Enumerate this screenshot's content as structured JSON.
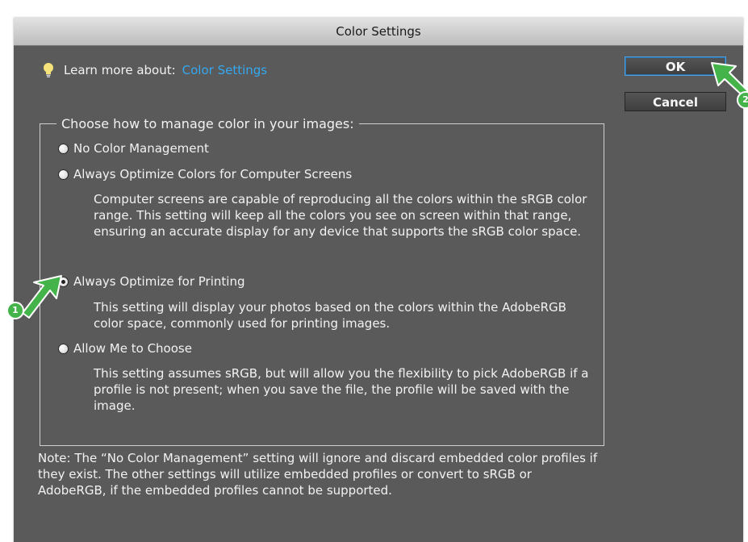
{
  "window": {
    "title": "Color Settings"
  },
  "learn": {
    "prefix": "Learn more about:",
    "link": "Color Settings",
    "icon": "lightbulb-icon"
  },
  "buttons": {
    "ok": "OK",
    "cancel": "Cancel"
  },
  "group": {
    "legend": "Choose how to manage color in your images:",
    "options": [
      {
        "label": "No Color Management",
        "checked": false,
        "description": ""
      },
      {
        "label": "Always Optimize Colors for Computer Screens",
        "checked": false,
        "description": "Computer screens are capable of reproducing all the colors within the sRGB color range. This setting will keep all the colors you see on screen within that range, ensuring an accurate display for any device that supports the sRGB color space."
      },
      {
        "label": "Always Optimize for Printing",
        "checked": true,
        "description": "This setting will display your photos based on the colors within the AdobeRGB color space, commonly used for printing images."
      },
      {
        "label": "Allow Me to Choose",
        "checked": false,
        "description": "This setting assumes sRGB, but will allow you the flexibility to pick AdobeRGB if a profile is not present; when you save the file, the profile will be saved with the image."
      }
    ]
  },
  "note": "Note: The “No Color Management” setting will ignore and discard embedded color profiles if they exist. The other settings will utilize embedded profiles or convert to sRGB or AdobeRGB, if the embedded profiles cannot be supported.",
  "callouts": [
    {
      "number": "1",
      "color": "#44b34a"
    },
    {
      "number": "2",
      "color": "#44b34a"
    }
  ],
  "colors": {
    "dialog_bg": "#5a5a5a",
    "link": "#35a8f0",
    "text": "#f2f2f2"
  }
}
